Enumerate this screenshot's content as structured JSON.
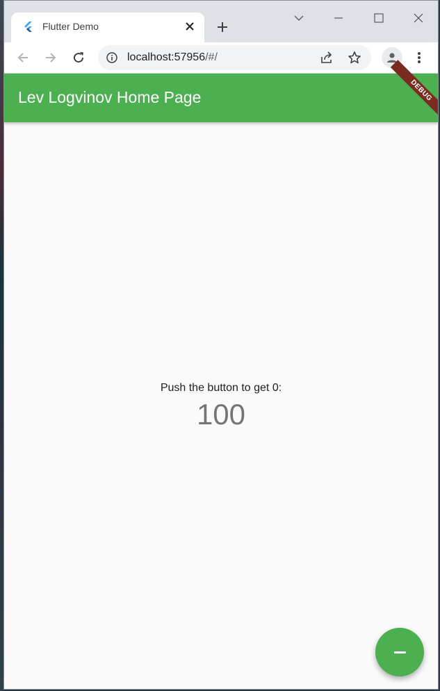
{
  "browser": {
    "tab": {
      "title": "Flutter Demo",
      "favicon": "flutter-logo-icon"
    },
    "url": {
      "host": "localhost:57956",
      "path": "/#/"
    },
    "icons": {
      "back": "arrow-left-icon",
      "forward": "arrow-right-icon",
      "reload": "reload-icon",
      "info": "info-icon",
      "share": "share-icon",
      "bookmark": "star-icon",
      "profile": "profile-icon",
      "menu": "kebab-menu-icon",
      "new_tab": "plus-icon",
      "tab_search": "chevron-down-icon",
      "minimize": "minimize-icon",
      "maximize": "maximize-icon",
      "close": "close-icon"
    }
  },
  "app": {
    "appbar_title": "Lev Logvinov Home Page",
    "debug_banner": "DEBUG",
    "prompt": "Push the button to get 0:",
    "counter": "100",
    "fab_icon": "minus-icon",
    "colors": {
      "primary": "#4caf50",
      "banner": "#7a2b20"
    }
  }
}
